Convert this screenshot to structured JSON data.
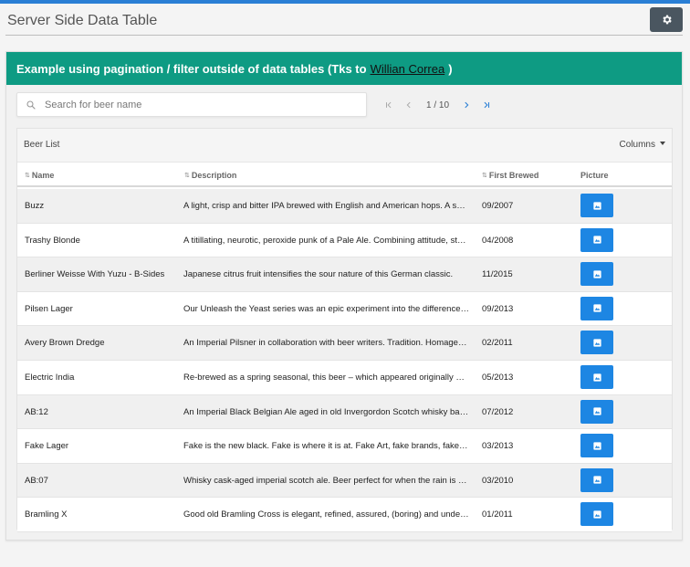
{
  "page": {
    "title": "Server Side Data Table"
  },
  "card": {
    "header_text": "Example using pagination / filter outside of data tables (Tks to",
    "link_text": "Willian Correa",
    "header_suffix": ")"
  },
  "search": {
    "placeholder": "Search for beer name",
    "value": ""
  },
  "pager": {
    "info": "1 / 10"
  },
  "table": {
    "title": "Beer List",
    "columns_label": "Columns",
    "headers": {
      "name": "Name",
      "description": "Description",
      "first_brewed": "First Brewed",
      "picture": "Picture"
    },
    "rows": [
      {
        "name": "Buzz",
        "description": "A light, crisp and bitter IPA brewed with English and American hops. A small batch brewed only once.",
        "first_brewed": "09/2007"
      },
      {
        "name": "Trashy Blonde",
        "description": "A titillating, neurotic, peroxide punk of a Pale Ale. Combining attitude, style, substance, and a little bit of low self esteem.",
        "first_brewed": "04/2008"
      },
      {
        "name": "Berliner Weisse With Yuzu - B-Sides",
        "description": "Japanese citrus fruit intensifies the sour nature of this German classic.",
        "first_brewed": "11/2015"
      },
      {
        "name": "Pilsen Lager",
        "description": "Our Unleash the Yeast series was an epic experiment into the differences in aroma and flavour.",
        "first_brewed": "09/2013"
      },
      {
        "name": "Avery Brown Dredge",
        "description": "An Imperial Pilsner in collaboration with beer writers. Tradition. Homage. Revolution.",
        "first_brewed": "02/2011"
      },
      {
        "name": "Electric India",
        "description": "Re-brewed as a spring seasonal, this beer – which appeared originally as an Equity Punk shareholder creation.",
        "first_brewed": "05/2013"
      },
      {
        "name": "AB:12",
        "description": "An Imperial Black Belgian Ale aged in old Invergordon Scotch whisky barrels with mountains of raspberries.",
        "first_brewed": "07/2012"
      },
      {
        "name": "Fake Lager",
        "description": "Fake is the new black. Fake is where it is at. Fake Art, fake brands, fake breasts, and fake lager.",
        "first_brewed": "03/2013"
      },
      {
        "name": "AB:07",
        "description": "Whisky cask-aged imperial scotch ale. Beer perfect for when the rain is coming down sideways.",
        "first_brewed": "03/2010"
      },
      {
        "name": "Bramling X",
        "description": "Good old Bramling Cross is elegant, refined, assured, (boring) and understated.",
        "first_brewed": "01/2011"
      }
    ]
  },
  "colors": {
    "header_green": "#0e9b83",
    "picture_button_blue": "#1d86e3",
    "settings_button": "#4a5660",
    "top_bar_blue": "#2a7fd5"
  },
  "icons": {
    "settings": "gear-icon",
    "search": "search-icon",
    "first_page": "first-page-icon",
    "prev_page": "chevron-left-icon",
    "next_page": "chevron-right-icon",
    "last_page": "last-page-icon",
    "sort": "sort-icon",
    "picture": "image-icon"
  }
}
